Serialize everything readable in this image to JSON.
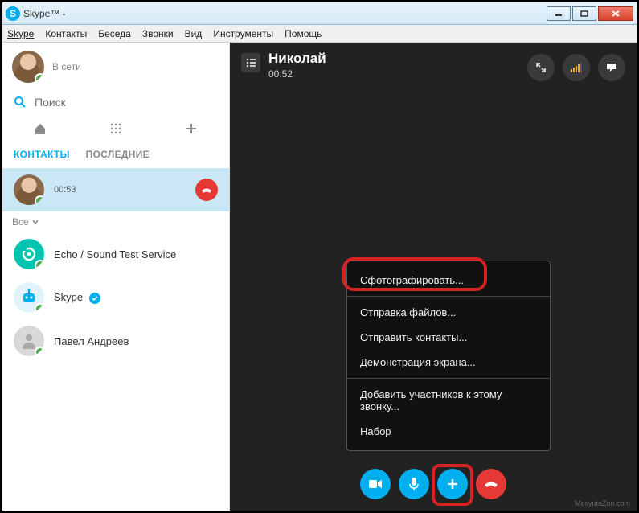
{
  "window": {
    "title_prefix": "Skype™ - "
  },
  "menubar": [
    "Skype",
    "Контакты",
    "Беседа",
    "Звонки",
    "Вид",
    "Инструменты",
    "Помощь"
  ],
  "me": {
    "name": "",
    "status": "В сети"
  },
  "search": {
    "placeholder": "Поиск"
  },
  "tabs": {
    "contacts": "КОНТАКТЫ",
    "recent": "ПОСЛЕДНИЕ"
  },
  "filter": {
    "label": "Все"
  },
  "active_call_item": {
    "name": "",
    "duration": "00:53"
  },
  "contacts": [
    {
      "name": "Echo / Sound Test Service"
    },
    {
      "name": "Skype",
      "verified": true
    },
    {
      "name": "Павел Андреев"
    }
  ],
  "call": {
    "name": "Николай",
    "duration": "00:52"
  },
  "popup": {
    "snapshot": "Сфотографировать...",
    "send_files": "Отправка файлов...",
    "send_contacts": "Отправить контакты...",
    "share_screen": "Демонстрация экрана...",
    "add_people": "Добавить участников к этому звонку...",
    "dialpad": "Набор"
  },
  "watermark": "MesyutaZon.com"
}
